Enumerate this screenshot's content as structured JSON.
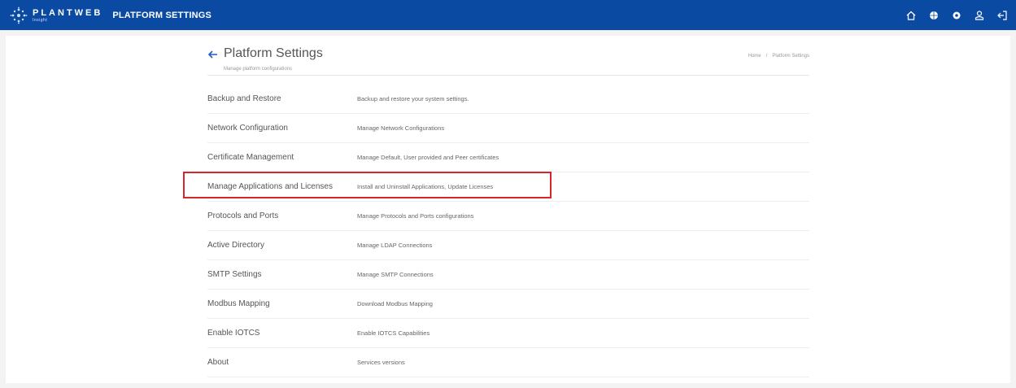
{
  "app": {
    "brand": "PLANTWEB",
    "brand_sub": "Insight",
    "title": "PLATFORM SETTINGS"
  },
  "top_icons": [
    "home-icon",
    "globe-icon",
    "settings-icon",
    "user-icon",
    "logout-icon"
  ],
  "header": {
    "title": "Platform Settings",
    "subtitle": "Manage platform configurations",
    "breadcrumb": [
      "Home",
      "Platform Settings"
    ]
  },
  "settings": [
    {
      "name": "Backup and Restore",
      "description": "Backup and restore your system settings."
    },
    {
      "name": "Network Configuration",
      "description": "Manage Network Configurations"
    },
    {
      "name": "Certificate Management",
      "description": "Manage Default, User provided and Peer certificates"
    },
    {
      "name": "Manage Applications and Licenses",
      "description": "Install and Uninstall Applications, Update Licenses"
    },
    {
      "name": "Protocols and Ports",
      "description": "Manage Protocols and Ports configurations"
    },
    {
      "name": "Active Directory",
      "description": "Manage LDAP Connections"
    },
    {
      "name": "SMTP Settings",
      "description": "Manage SMTP Connections"
    },
    {
      "name": "Modbus Mapping",
      "description": "Download Modbus Mapping"
    },
    {
      "name": "Enable IOTCS",
      "description": "Enable IOTCS Capabilities"
    },
    {
      "name": "About",
      "description": "Services versions"
    }
  ],
  "colors": {
    "topbar": "#0a4aa3",
    "highlight": "#d8242b"
  }
}
